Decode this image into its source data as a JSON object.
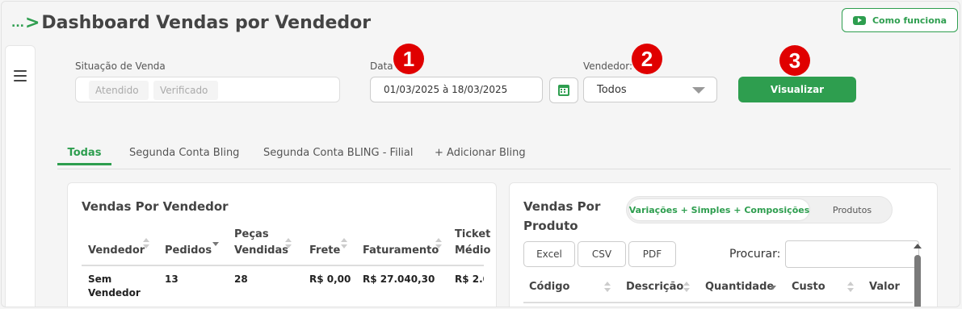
{
  "header": {
    "breadcrumb_dots": "...",
    "breadcrumb_chevron": ">",
    "title": "Dashboard Vendas por Vendedor",
    "how_it_works_label": "Como funciona"
  },
  "filters": {
    "situacao_label": "Situação de Venda",
    "situacao_chips": [
      "Atendido",
      "Verificado"
    ],
    "date_label": "Data",
    "date_value": "01/03/2025 à 18/03/2025",
    "vendedor_label": "Vendedor:",
    "vendedor_value": "Todos",
    "visualizar_label": "Visualizar"
  },
  "badges": [
    "1",
    "2",
    "3"
  ],
  "tabs": [
    {
      "label": "Todas",
      "active": true
    },
    {
      "label": "Segunda Conta Bling",
      "active": false
    },
    {
      "label": "Segunda Conta BLING - Filial",
      "active": false
    },
    {
      "label": "+ Adicionar Bling",
      "active": false
    }
  ],
  "vendas_vendedor": {
    "title": "Vendas Por Vendedor",
    "columns": [
      "Vendedor",
      "Pedidos",
      "Peças Vendidas",
      "Frete",
      "Faturamento",
      "Ticket Médio"
    ],
    "rows": [
      {
        "vendedor": "Sem Vendedor",
        "pedidos": "13",
        "pecas": "28",
        "frete": "R$ 0,00",
        "faturamento": "R$ 27.040,30",
        "ticket": "R$ 2.0"
      }
    ]
  },
  "vendas_produto": {
    "title": "Vendas Por Produto",
    "segment_options": [
      "Variações + Simples + Composições",
      "Produtos"
    ],
    "export_buttons": [
      "Excel",
      "CSV",
      "PDF"
    ],
    "search_label": "Procurar:",
    "search_value": "",
    "columns": [
      "Código",
      "Descrição",
      "Quantidade",
      "Custo",
      "Valor"
    ]
  },
  "colors": {
    "brand_green": "#2e9e4f",
    "badge_red": "#e00000"
  },
  "icons": [
    "hamburger-menu-icon",
    "youtube-play-icon",
    "calendar-icon",
    "dropdown-caret-icon",
    "sort-arrows-icon"
  ]
}
